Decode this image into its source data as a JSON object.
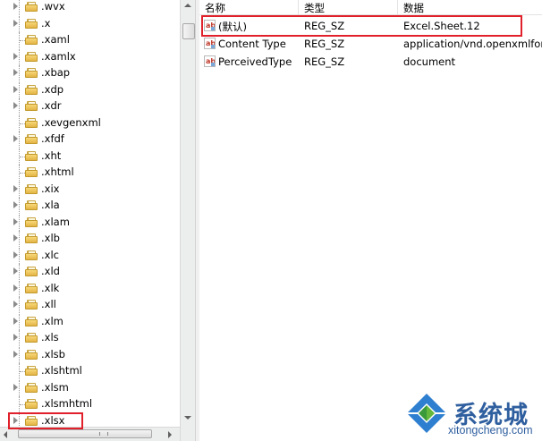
{
  "tree": {
    "items": [
      {
        "label": ".wvx",
        "expandable": true
      },
      {
        "label": ".x",
        "expandable": true
      },
      {
        "label": ".xaml",
        "expandable": false
      },
      {
        "label": ".xamlx",
        "expandable": true
      },
      {
        "label": ".xbap",
        "expandable": true
      },
      {
        "label": ".xdp",
        "expandable": true
      },
      {
        "label": ".xdr",
        "expandable": true
      },
      {
        "label": ".xevgenxml",
        "expandable": false
      },
      {
        "label": ".xfdf",
        "expandable": true
      },
      {
        "label": ".xht",
        "expandable": false
      },
      {
        "label": ".xhtml",
        "expandable": false
      },
      {
        "label": ".xix",
        "expandable": true
      },
      {
        "label": ".xla",
        "expandable": true
      },
      {
        "label": ".xlam",
        "expandable": true
      },
      {
        "label": ".xlb",
        "expandable": true
      },
      {
        "label": ".xlc",
        "expandable": true
      },
      {
        "label": ".xld",
        "expandable": true
      },
      {
        "label": ".xlk",
        "expandable": true
      },
      {
        "label": ".xll",
        "expandable": true
      },
      {
        "label": ".xlm",
        "expandable": true
      },
      {
        "label": ".xls",
        "expandable": true
      },
      {
        "label": ".xlsb",
        "expandable": true
      },
      {
        "label": ".xlshtml",
        "expandable": false
      },
      {
        "label": ".xlsm",
        "expandable": true
      },
      {
        "label": ".xlsmhtml",
        "expandable": false
      },
      {
        "label": ".xlsx",
        "expandable": true,
        "highlighted": true
      }
    ]
  },
  "list": {
    "columns": {
      "name": "名称",
      "type": "类型",
      "data": "数据"
    },
    "rows": [
      {
        "name": "(默认)",
        "type": "REG_SZ",
        "data": "Excel.Sheet.12",
        "highlighted": true
      },
      {
        "name": "Content Type",
        "type": "REG_SZ",
        "data": "application/vnd.openxmlform"
      },
      {
        "name": "PerceivedType",
        "type": "REG_SZ",
        "data": "document"
      }
    ],
    "value_icon_text": "ab"
  },
  "logo": {
    "text": "系统城",
    "url": "xitongcheng.com",
    "colors": {
      "blue": "#2f7fd1",
      "green": "#3a9a3a",
      "text": "#2f5f9f"
    }
  },
  "colors": {
    "highlight_border": "#e0202a",
    "folder": "#e3b445"
  }
}
